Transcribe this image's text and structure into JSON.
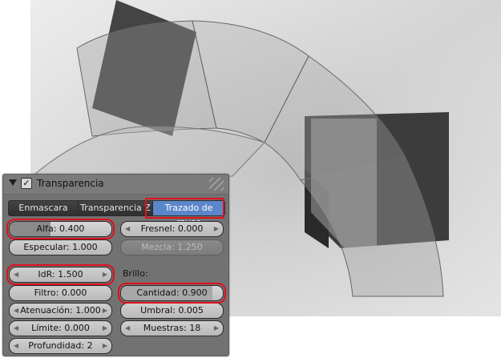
{
  "panel": {
    "title": "Transparencia",
    "checked": true,
    "tabs": [
      {
        "label": "Enmascara",
        "selected": false
      },
      {
        "label": "Transparencia Z",
        "selected": false
      },
      {
        "label": "Trazado de rayos",
        "selected": true
      }
    ],
    "fields": {
      "alfa": "Alfa: 0.400",
      "fresnel": "Fresnel: 0.000",
      "especular": "Especular: 1.000",
      "mezcla": "Mezcla: 1.250",
      "idr": "IdR: 1.500",
      "brillo_label": "Brillo:",
      "filtro": "Filtro: 0.000",
      "cantidad": "Cantidad: 0.900",
      "atenuacion": "Atenuación: 1.000",
      "umbral": "Umbral: 0.005",
      "limite": "Límite: 0.000",
      "muestras": "Muestras: 18",
      "profundidad": "Profundidad: 2"
    },
    "slider_values": {
      "alfa": 0.4,
      "cantidad": 0.9
    }
  },
  "colors": {
    "highlight": "#e0101c",
    "selected_tab": "#5b86c9",
    "panel_bg": "#727272"
  }
}
